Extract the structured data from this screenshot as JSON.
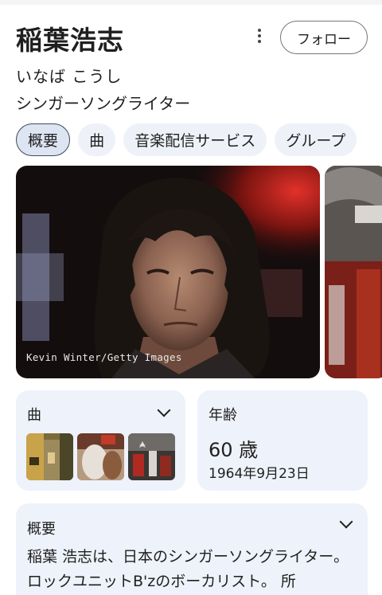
{
  "entity": {
    "name": "稲葉浩志",
    "reading": "いなば こうし",
    "role": "シンガーソングライター",
    "follow_label": "フォロー"
  },
  "chips": [
    {
      "label": "概要",
      "active": true
    },
    {
      "label": "曲",
      "active": false
    },
    {
      "label": "音楽配信サービス",
      "active": false
    },
    {
      "label": "グループ",
      "active": false
    }
  ],
  "photo": {
    "credit": "Kevin Winter/Getty Images"
  },
  "songs_card": {
    "heading": "曲",
    "icon": "chevron-down-icon"
  },
  "age_card": {
    "heading": "年齢",
    "age": "60 歳",
    "birthdate": "1964年9月23日"
  },
  "overview_card": {
    "heading": "概要",
    "icon": "chevron-down-icon",
    "text": "稲葉 浩志は、日本のシンガーソングライター。ロックユニットB'zのボーカリスト。 所"
  },
  "colors": {
    "card_bg": "#eef2fa",
    "chip_bg": "#eef1f8",
    "chip_active_bg": "#dde5f3",
    "text": "#1f1f1f"
  }
}
